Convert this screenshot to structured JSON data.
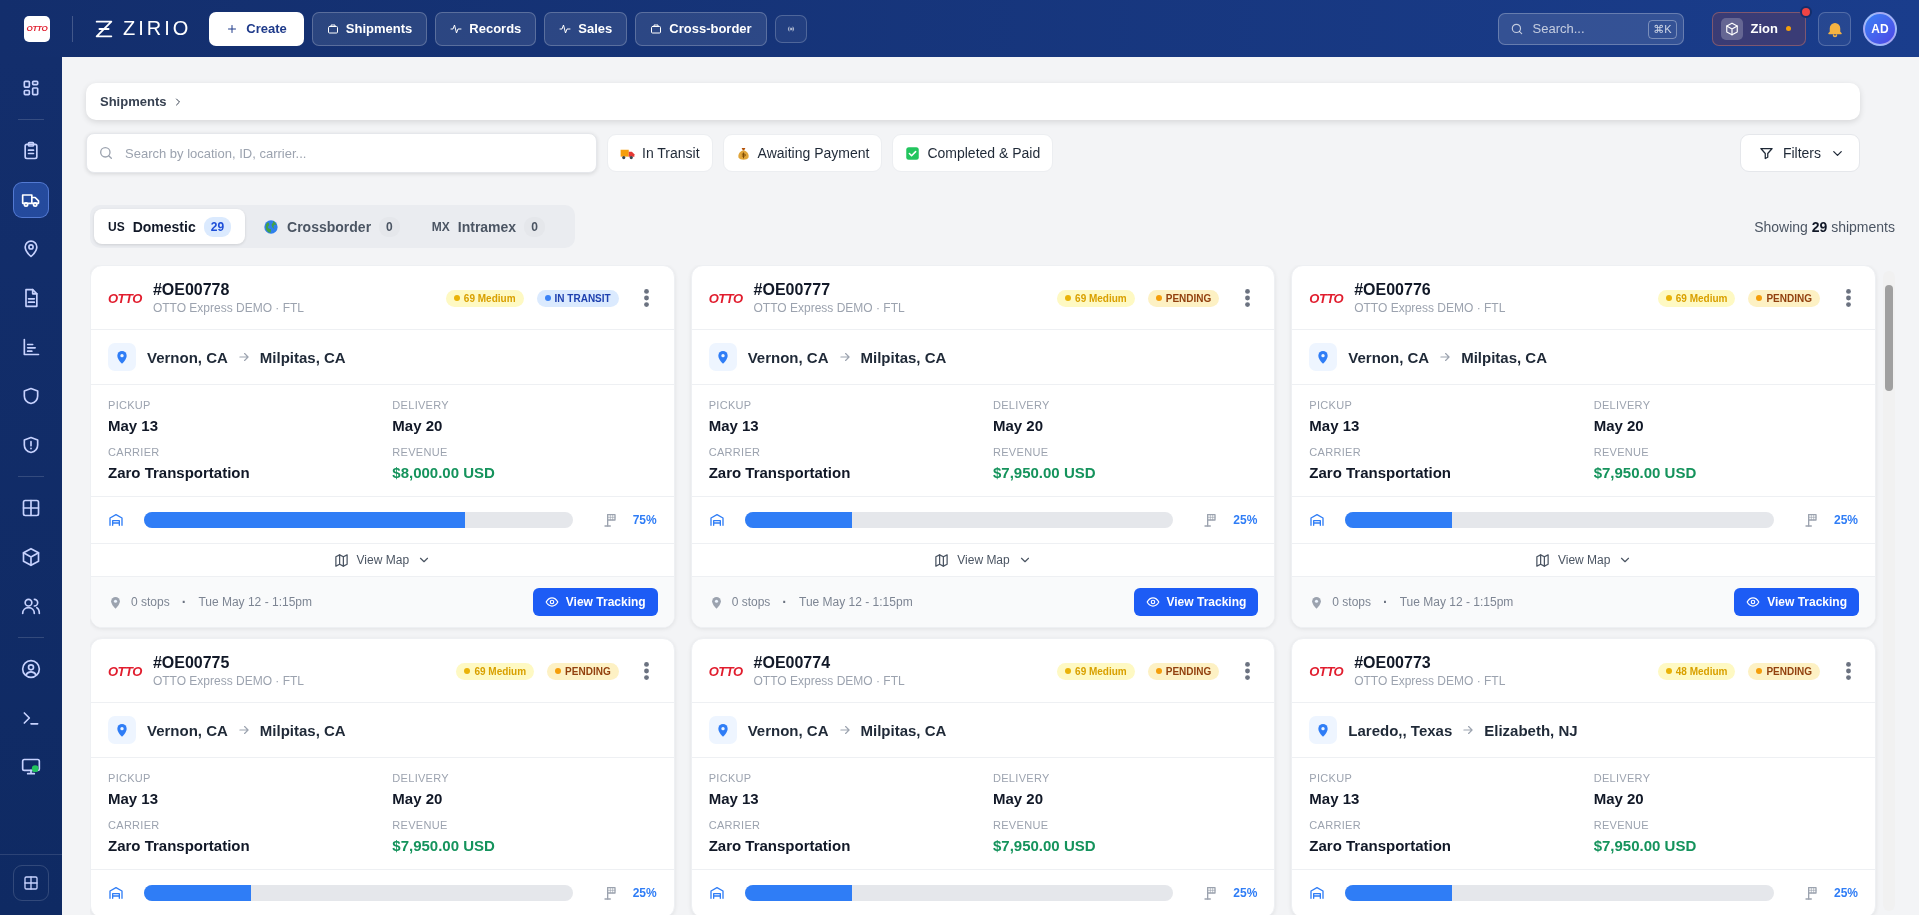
{
  "topbar": {
    "logo": "OTTO",
    "brand": "ZIRIO",
    "create_button": "Create",
    "nav": [
      {
        "label": "Shipments",
        "kind": "case"
      },
      {
        "label": "Records",
        "kind": "pulse"
      },
      {
        "label": "Sales",
        "kind": "pulse"
      },
      {
        "label": "Cross-border",
        "kind": "case"
      }
    ],
    "search": {
      "placeholder": "Search...",
      "shortcut": "⌘K"
    },
    "workspace": {
      "name": "Zion",
      "alert": true,
      "online": true
    },
    "avatar": "AD"
  },
  "sidebar": {
    "groups": [
      {
        "items": [
          {
            "kind": "dashboard",
            "selected": false
          }
        ]
      },
      {
        "items": [
          {
            "kind": "clipboard",
            "selected": false
          },
          {
            "kind": "truck",
            "selected": true
          },
          {
            "kind": "pin",
            "selected": false
          },
          {
            "kind": "document",
            "selected": false
          },
          {
            "kind": "chart",
            "selected": false
          },
          {
            "kind": "shield",
            "selected": false
          },
          {
            "kind": "alert",
            "selected": false
          }
        ]
      },
      {
        "items": [
          {
            "kind": "table",
            "selected": false
          },
          {
            "kind": "cube",
            "selected": false
          },
          {
            "kind": "users",
            "selected": false
          }
        ]
      },
      {
        "items": [
          {
            "kind": "profile",
            "selected": false
          },
          {
            "kind": "terminal",
            "selected": false
          },
          {
            "kind": "monitor",
            "selected": false
          }
        ]
      }
    ]
  },
  "breadcrumb": [
    "Shipments"
  ],
  "search": {
    "placeholder": "Search by location, ID, carrier..."
  },
  "quick_filters": [
    {
      "label": "In Transit",
      "kind": "truck"
    },
    {
      "label": "Awaiting Payment",
      "kind": "money"
    },
    {
      "label": "Completed & Paid",
      "kind": "check"
    }
  ],
  "filters_button": "Filters",
  "tabs": [
    {
      "prefix": "US",
      "label": "Domestic",
      "count": "29",
      "selected": true
    },
    {
      "label": "Crossborder",
      "count": "0",
      "selected": false
    },
    {
      "prefix": "MX",
      "label": "Intramex",
      "count": "0",
      "selected": false
    }
  ],
  "summary": "Showing **29** shipments",
  "cards": [
    {
      "logo": "OTTO",
      "id": "#OE00778",
      "subtitle": "OTTO Express DEMO · FTL",
      "score": "69 Medium",
      "status": {
        "label": "IN TRANSIT",
        "kind": "transit"
      },
      "from": "Vernon, CA",
      "to": "Milpitas, CA",
      "fields": [
        {
          "label": "PICKUP",
          "value": "May 13",
          "kind": "text"
        },
        {
          "label": "DELIVERY",
          "value": "May 20",
          "kind": "text"
        },
        {
          "label": "CARRIER",
          "value": "Zaro Transportation",
          "kind": "text"
        },
        {
          "label": "REVENUE",
          "value": "$8,000.00 USD",
          "kind": "money"
        }
      ],
      "level": 0.75,
      "percent": "75%",
      "map_toggle": "View Map",
      "stops": "0 stops",
      "separator": "·",
      "time": "Tue May 12 - 1:15pm",
      "action": "View Tracking"
    },
    {
      "logo": "OTTO",
      "id": "#OE00777",
      "subtitle": "OTTO Express DEMO · FTL",
      "score": "69 Medium",
      "status": {
        "label": "PENDING",
        "kind": "pending"
      },
      "from": "Vernon, CA",
      "to": "Milpitas, CA",
      "fields": [
        {
          "label": "PICKUP",
          "value": "May 13",
          "kind": "text"
        },
        {
          "label": "DELIVERY",
          "value": "May 20",
          "kind": "text"
        },
        {
          "label": "CARRIER",
          "value": "Zaro Transportation",
          "kind": "text"
        },
        {
          "label": "REVENUE",
          "value": "$7,950.00 USD",
          "kind": "money"
        }
      ],
      "level": 0.25,
      "percent": "25%",
      "map_toggle": "View Map",
      "stops": "0 stops",
      "separator": "·",
      "time": "Tue May 12 - 1:15pm",
      "action": "View Tracking"
    },
    {
      "logo": "OTTO",
      "id": "#OE00776",
      "subtitle": "OTTO Express DEMO · FTL",
      "score": "69 Medium",
      "status": {
        "label": "PENDING",
        "kind": "pending"
      },
      "from": "Vernon, CA",
      "to": "Milpitas, CA",
      "fields": [
        {
          "label": "PICKUP",
          "value": "May 13",
          "kind": "text"
        },
        {
          "label": "DELIVERY",
          "value": "May 20",
          "kind": "text"
        },
        {
          "label": "CARRIER",
          "value": "Zaro Transportation",
          "kind": "text"
        },
        {
          "label": "REVENUE",
          "value": "$7,950.00 USD",
          "kind": "money"
        }
      ],
      "level": 0.25,
      "percent": "25%",
      "map_toggle": "View Map",
      "stops": "0 stops",
      "separator": "·",
      "time": "Tue May 12 - 1:15pm",
      "action": "View Tracking"
    },
    {
      "logo": "OTTO",
      "id": "#OE00775",
      "subtitle": "OTTO Express DEMO · FTL",
      "score": "69 Medium",
      "status": {
        "label": "PENDING",
        "kind": "pending"
      },
      "from": "Vernon, CA",
      "to": "Milpitas, CA",
      "fields": [
        {
          "label": "PICKUP",
          "value": "May 13",
          "kind": "text"
        },
        {
          "label": "DELIVERY",
          "value": "May 20",
          "kind": "text"
        },
        {
          "label": "CARRIER",
          "value": "Zaro Transportation",
          "kind": "text"
        },
        {
          "label": "REVENUE",
          "value": "$7,950.00 USD",
          "kind": "money"
        }
      ],
      "level": 0.25,
      "percent": "25%"
    },
    {
      "logo": "OTTO",
      "id": "#OE00774",
      "subtitle": "OTTO Express DEMO · FTL",
      "score": "69 Medium",
      "status": {
        "label": "PENDING",
        "kind": "pending"
      },
      "from": "Vernon, CA",
      "to": "Milpitas, CA",
      "fields": [
        {
          "label": "PICKUP",
          "value": "May 13",
          "kind": "text"
        },
        {
          "label": "DELIVERY",
          "value": "May 20",
          "kind": "text"
        },
        {
          "label": "CARRIER",
          "value": "Zaro Transportation",
          "kind": "text"
        },
        {
          "label": "REVENUE",
          "value": "$7,950.00 USD",
          "kind": "money"
        }
      ],
      "level": 0.25,
      "percent": "25%"
    },
    {
      "logo": "OTTO",
      "id": "#OE00773",
      "subtitle": "OTTO Express DEMO · FTL",
      "score": "48 Medium",
      "status": {
        "label": "PENDING",
        "kind": "pending"
      },
      "from": "Laredo,, Texas",
      "to": "Elizabeth, NJ",
      "fields": [
        {
          "label": "PICKUP",
          "value": "May 13",
          "kind": "text"
        },
        {
          "label": "DELIVERY",
          "value": "May 20",
          "kind": "text"
        },
        {
          "label": "CARRIER",
          "value": "Zaro Transportation",
          "kind": "text"
        },
        {
          "label": "REVENUE",
          "value": "$7,950.00 USD",
          "kind": "money"
        }
      ],
      "level": 0.25,
      "percent": "25%"
    }
  ]
}
